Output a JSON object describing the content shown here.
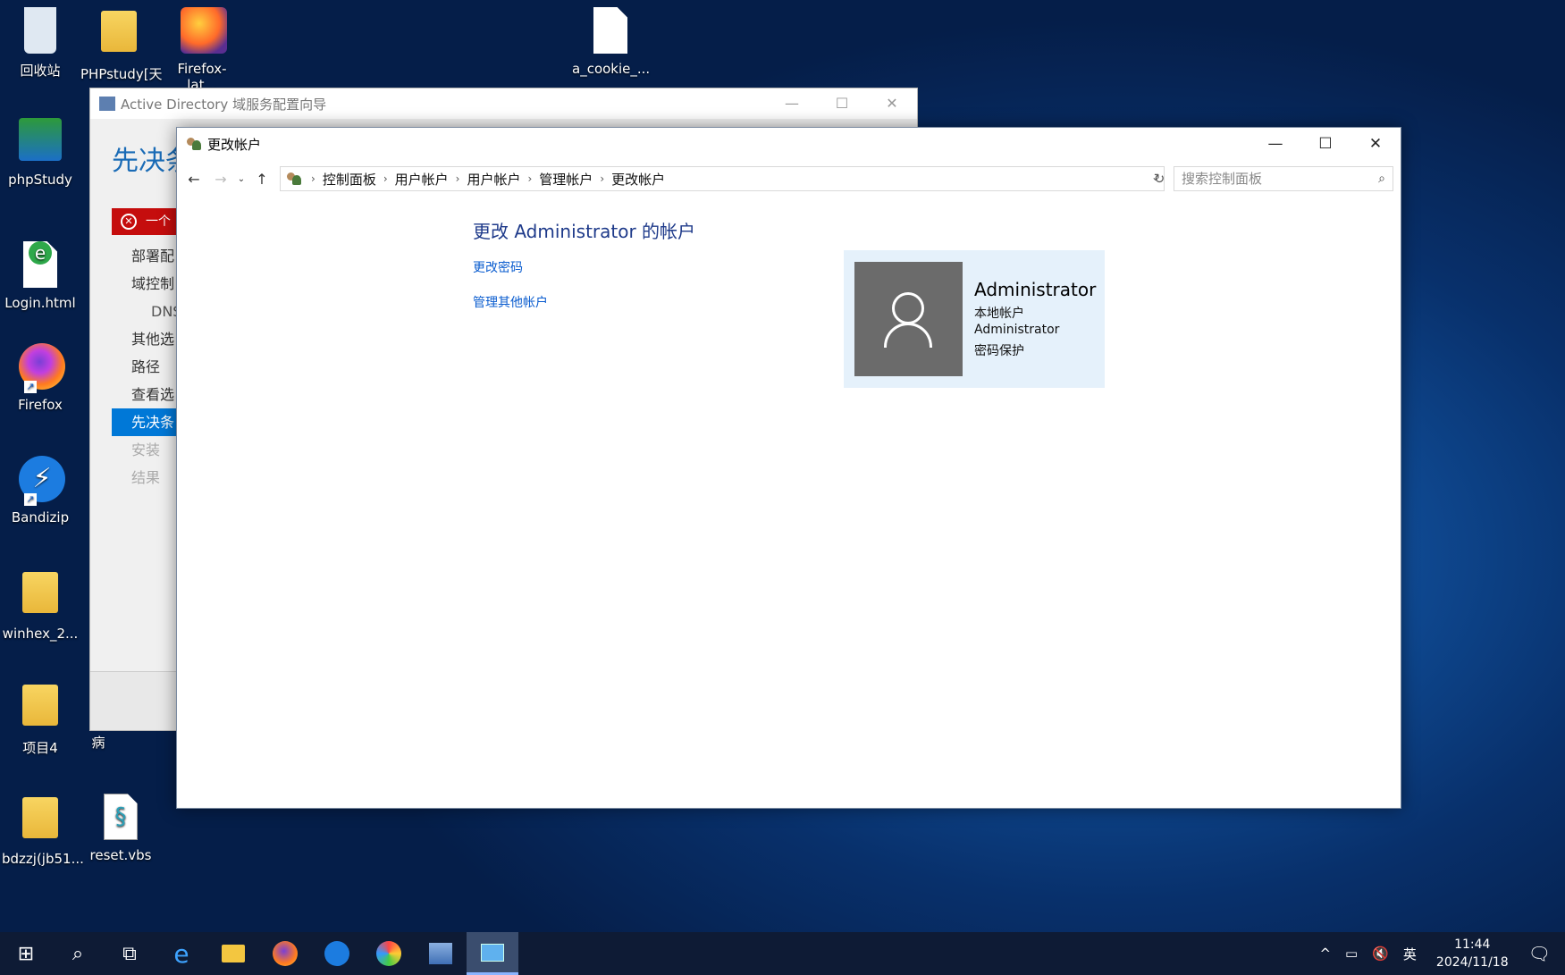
{
  "desktop": {
    "icons": [
      {
        "label": "回收站",
        "type": "recycle-bin"
      },
      {
        "label": "PHPstudy[天",
        "type": "folder"
      },
      {
        "label": "Firefox-lat...",
        "type": "installer"
      },
      {
        "label": "a_cookie_...",
        "type": "file"
      },
      {
        "label": "phpStudy",
        "type": "app"
      },
      {
        "label": "Login.html",
        "type": "html"
      },
      {
        "label": "Firefox",
        "type": "firefox"
      },
      {
        "label": "Bandizip",
        "type": "bandizip"
      },
      {
        "label": "winhex_2...",
        "type": "folder"
      },
      {
        "label": "项目4",
        "type": "folder"
      },
      {
        "label": "病",
        "type": "folder"
      },
      {
        "label": "bdzzj(jb51...",
        "type": "folder"
      },
      {
        "label": "reset.vbs",
        "type": "script"
      }
    ]
  },
  "ad_window": {
    "title": "Active Directory 域服务配置向导",
    "heading": "先决条",
    "error": "一个",
    "nav": [
      "部署配",
      "域控制",
      "DNS",
      "其他选",
      "路径",
      "查看选",
      "先决条",
      "安装",
      "结果"
    ]
  },
  "window": {
    "title": "更改帐户",
    "breadcrumb": [
      "控制面板",
      "用户帐户",
      "用户帐户",
      "管理帐户",
      "更改帐户"
    ],
    "search_placeholder": "搜索控制面板",
    "heading": "更改 Administrator 的帐户",
    "links": [
      "更改密码",
      "管理其他帐户"
    ],
    "account": {
      "name": "Administrator",
      "type": "本地帐户",
      "group": "Administrator",
      "status": "密码保护"
    }
  },
  "taskbar": {
    "ime": "英",
    "time": "11:44",
    "date": "2024/11/18"
  }
}
